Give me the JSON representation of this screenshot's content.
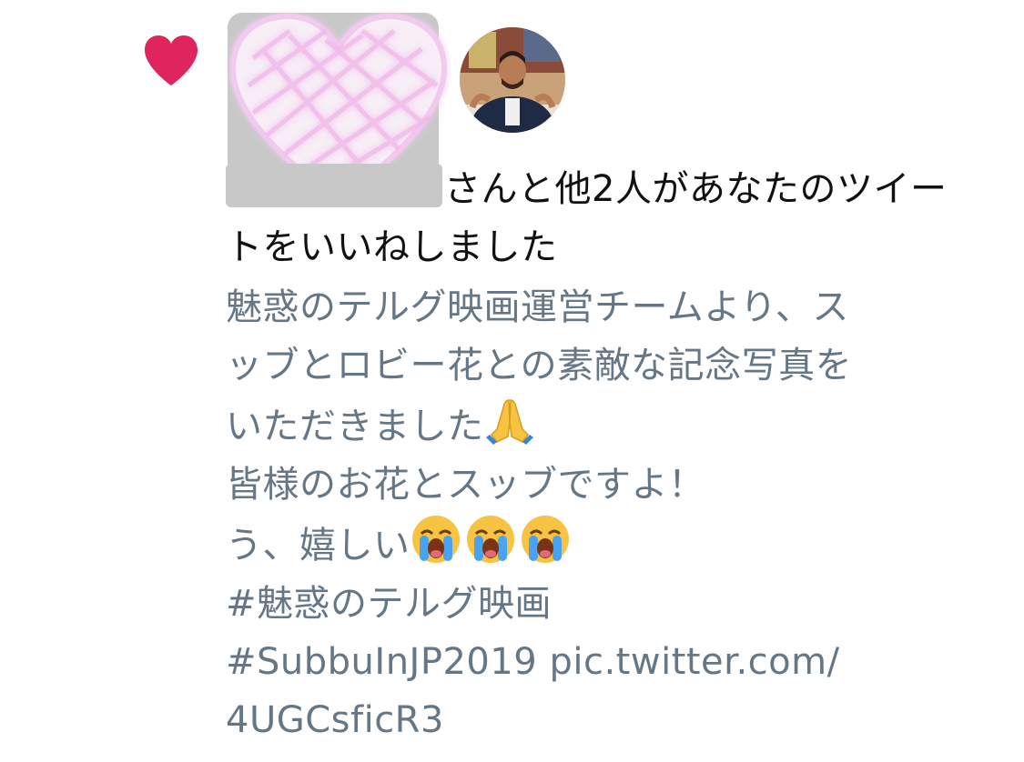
{
  "notification": {
    "icon": "heart-icon",
    "colors": {
      "heart": "#e0245e",
      "headline_text": "#111111",
      "tweet_text": "#657786",
      "redaction": "#c8c8c8"
    },
    "headline": "さんと他2人があなたのツイートをいいねしました",
    "tweet": {
      "line1": "魅惑のテルグ映画運営チームより、ス",
      "line2": "ッブとロビー花との素敵な記念写真を",
      "line3": "いただきました",
      "line3_emoji": "folded-hands-emoji",
      "line4": "皆様のお花とスッブですよ！",
      "line5": "う、嬉しい",
      "line5_emoji": [
        "loudly-crying-face-emoji",
        "loudly-crying-face-emoji",
        "loudly-crying-face-emoji"
      ],
      "line6": "#魅惑のテルグ映画",
      "line7": "#SubbuInJP2019 pic.twitter.com/",
      "line8": "4UGCsficR3"
    }
  }
}
